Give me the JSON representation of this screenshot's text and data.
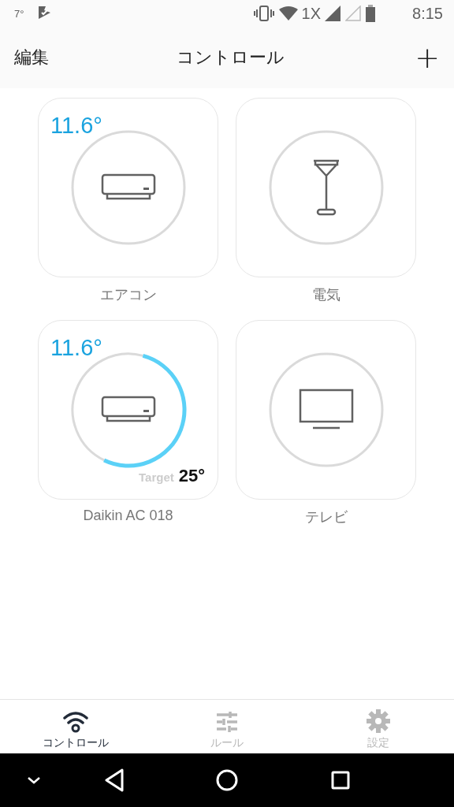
{
  "status_bar": {
    "temperature": "7°",
    "network": "1X",
    "time": "8:15"
  },
  "header": {
    "edit": "編集",
    "title": "コントロール",
    "add": "+"
  },
  "devices": [
    {
      "kind": "ac",
      "name": "エアコン",
      "temperature": "11.6°"
    },
    {
      "kind": "lamp",
      "name": "電気"
    },
    {
      "kind": "ac",
      "name": "Daikin AC 018",
      "temperature": "11.6°",
      "target_label": "Target",
      "target": "25°"
    },
    {
      "kind": "tv",
      "name": "テレビ"
    }
  ],
  "tabs": [
    {
      "kind": "wifi",
      "label": "コントロール",
      "selected": true
    },
    {
      "kind": "sliders",
      "label": "ルール",
      "selected": false
    },
    {
      "kind": "gear",
      "label": "設定",
      "selected": false
    }
  ]
}
